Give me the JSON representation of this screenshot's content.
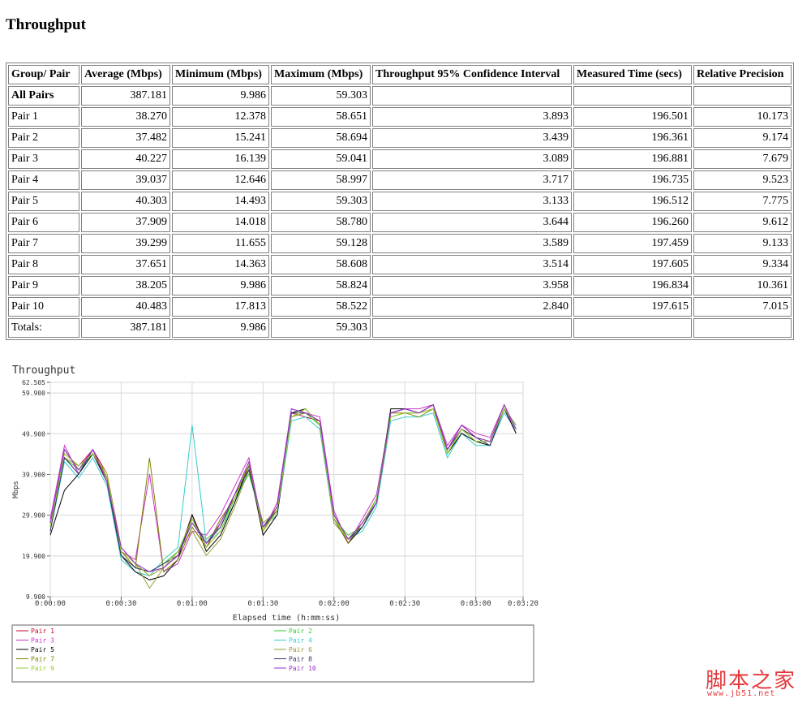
{
  "report": {
    "title": "Throughput",
    "table": {
      "headers": [
        "Group/ Pair",
        "Average (Mbps)",
        "Minimum (Mbps)",
        "Maximum (Mbps)",
        "Throughput 95% Confidence Interval",
        "Measured Time (secs)",
        "Relative Precision"
      ],
      "rows": [
        [
          "All Pairs",
          "387.181",
          "9.986",
          "59.303",
          "",
          "",
          ""
        ],
        [
          "Pair 1",
          "38.270",
          "12.378",
          "58.651",
          "3.893",
          "196.501",
          "10.173"
        ],
        [
          "Pair 2",
          "37.482",
          "15.241",
          "58.694",
          "3.439",
          "196.361",
          "9.174"
        ],
        [
          "Pair 3",
          "40.227",
          "16.139",
          "59.041",
          "3.089",
          "196.881",
          "7.679"
        ],
        [
          "Pair 4",
          "39.037",
          "12.646",
          "58.997",
          "3.717",
          "196.735",
          "9.523"
        ],
        [
          "Pair 5",
          "40.303",
          "14.493",
          "59.303",
          "3.133",
          "196.512",
          "7.775"
        ],
        [
          "Pair 6",
          "37.909",
          "14.018",
          "58.780",
          "3.644",
          "196.260",
          "9.612"
        ],
        [
          "Pair 7",
          "39.299",
          "11.655",
          "59.128",
          "3.589",
          "197.459",
          "9.133"
        ],
        [
          "Pair 8",
          "37.651",
          "14.363",
          "58.608",
          "3.514",
          "197.605",
          "9.334"
        ],
        [
          "Pair 9",
          "38.205",
          "9.986",
          "58.824",
          "3.958",
          "196.834",
          "10.361"
        ],
        [
          "Pair 10",
          "40.483",
          "17.813",
          "58.522",
          "2.840",
          "197.615",
          "7.015"
        ],
        [
          "Totals:",
          "387.181",
          "9.986",
          "59.303",
          "",
          "",
          ""
        ]
      ]
    }
  },
  "chart_data": {
    "type": "line",
    "title": "Throughput",
    "xlabel": "Elapsed time (h:mm:ss)",
    "ylabel": "Mbps",
    "xlim": [
      0,
      200
    ],
    "ylim": [
      9.9,
      62.505
    ],
    "x_ticks": [
      {
        "value": 0,
        "label": "0:00:00"
      },
      {
        "value": 30,
        "label": "0:00:30"
      },
      {
        "value": 60,
        "label": "0:01:00"
      },
      {
        "value": 90,
        "label": "0:01:30"
      },
      {
        "value": 120,
        "label": "0:02:00"
      },
      {
        "value": 150,
        "label": "0:02:30"
      },
      {
        "value": 180,
        "label": "0:03:00"
      },
      {
        "value": 200,
        "label": "0:03:20"
      }
    ],
    "y_ticks": [
      {
        "value": 9.9,
        "label": "9.900"
      },
      {
        "value": 19.9,
        "label": "19.900"
      },
      {
        "value": 29.9,
        "label": "29.900"
      },
      {
        "value": 39.9,
        "label": "39.900"
      },
      {
        "value": 49.9,
        "label": "49.900"
      },
      {
        "value": 59.9,
        "label": "59.900"
      },
      {
        "value": 62.505,
        "label": "62.505"
      }
    ],
    "grid": true,
    "legend": "bottom",
    "x": [
      0,
      6,
      12,
      18,
      24,
      30,
      36,
      42,
      48,
      54,
      60,
      66,
      72,
      78,
      84,
      90,
      96,
      102,
      108,
      114,
      120,
      126,
      132,
      138,
      144,
      150,
      156,
      162,
      168,
      174,
      180,
      186,
      192,
      197
    ],
    "series": [
      {
        "name": "Pair 1",
        "color": "#cc0033",
        "values": [
          28,
          45,
          42,
          46,
          40,
          22,
          18,
          15,
          17,
          20,
          30,
          22,
          28,
          35,
          42,
          27,
          32,
          55,
          54,
          53,
          30,
          24,
          28,
          33,
          55,
          56,
          55,
          57,
          46,
          52,
          49,
          48,
          57,
          51
        ]
      },
      {
        "name": "Pair 2",
        "color": "#33cc33",
        "values": [
          27,
          44,
          41,
          45,
          39,
          20,
          17,
          16,
          18,
          21,
          28,
          24,
          27,
          34,
          40,
          28,
          31,
          54,
          55,
          52,
          29,
          25,
          27,
          34,
          54,
          55,
          54,
          56,
          45,
          51,
          48,
          47,
          56,
          52
        ]
      },
      {
        "name": "Pair 3",
        "color": "#cc33cc",
        "values": [
          29,
          47,
          40,
          46,
          38,
          21,
          19,
          40,
          16,
          18,
          26,
          25,
          30,
          37,
          44,
          26,
          33,
          56,
          55,
          54,
          31,
          23,
          29,
          35,
          55,
          56,
          56,
          57,
          47,
          52,
          50,
          49,
          57,
          50
        ]
      },
      {
        "name": "Pair 4",
        "color": "#33cccc",
        "values": [
          26,
          43,
          39,
          44,
          37,
          19,
          16,
          15,
          19,
          22,
          52,
          23,
          26,
          33,
          41,
          27,
          30,
          53,
          54,
          51,
          28,
          24,
          26,
          32,
          53,
          54,
          54,
          55,
          44,
          50,
          47,
          47,
          55,
          51
        ]
      },
      {
        "name": "Pair 5",
        "color": "#000000",
        "values": [
          25,
          36,
          40,
          45,
          38,
          20,
          16,
          14,
          15,
          19,
          30,
          21,
          25,
          33,
          42,
          25,
          30,
          55,
          56,
          52,
          29,
          23,
          27,
          33,
          56,
          56,
          55,
          57,
          45,
          50,
          48,
          47,
          56,
          50
        ]
      },
      {
        "name": "Pair 6",
        "color": "#999933",
        "values": [
          28,
          44,
          42,
          45,
          39,
          22,
          18,
          12,
          17,
          21,
          26,
          20,
          24,
          32,
          41,
          28,
          31,
          54,
          55,
          53,
          28,
          24,
          28,
          33,
          54,
          55,
          54,
          56,
          46,
          51,
          49,
          48,
          56,
          52
        ]
      },
      {
        "name": "Pair 7",
        "color": "#808000",
        "values": [
          27,
          46,
          41,
          46,
          39,
          21,
          17,
          44,
          16,
          19,
          27,
          22,
          29,
          34,
          42,
          26,
          32,
          54,
          56,
          52,
          29,
          23,
          28,
          34,
          55,
          55,
          55,
          56,
          45,
          51,
          48,
          48,
          57,
          51
        ]
      },
      {
        "name": "Pair 8",
        "color": "#333366",
        "values": [
          26,
          44,
          40,
          46,
          38,
          20,
          17,
          16,
          18,
          20,
          29,
          23,
          27,
          35,
          41,
          27,
          31,
          55,
          55,
          53,
          30,
          24,
          27,
          33,
          55,
          56,
          55,
          57,
          46,
          51,
          49,
          47,
          56,
          52
        ]
      },
      {
        "name": "Pair 9",
        "color": "#99cc33",
        "values": [
          27,
          45,
          42,
          45,
          40,
          21,
          18,
          15,
          17,
          21,
          29,
          22,
          26,
          34,
          43,
          26,
          31,
          54,
          56,
          52,
          29,
          24,
          28,
          34,
          54,
          55,
          55,
          56,
          45,
          51,
          48,
          48,
          56,
          52
        ]
      },
      {
        "name": "Pair 10",
        "color": "#9933cc",
        "values": [
          28,
          46,
          41,
          46,
          38,
          22,
          18,
          16,
          17,
          20,
          28,
          23,
          28,
          35,
          43,
          27,
          32,
          56,
          55,
          53,
          30,
          24,
          28,
          33,
          55,
          56,
          55,
          57,
          46,
          52,
          49,
          48,
          57,
          51
        ]
      }
    ]
  },
  "watermark": {
    "name": "脚本之家",
    "url": "www.jb51.net"
  }
}
